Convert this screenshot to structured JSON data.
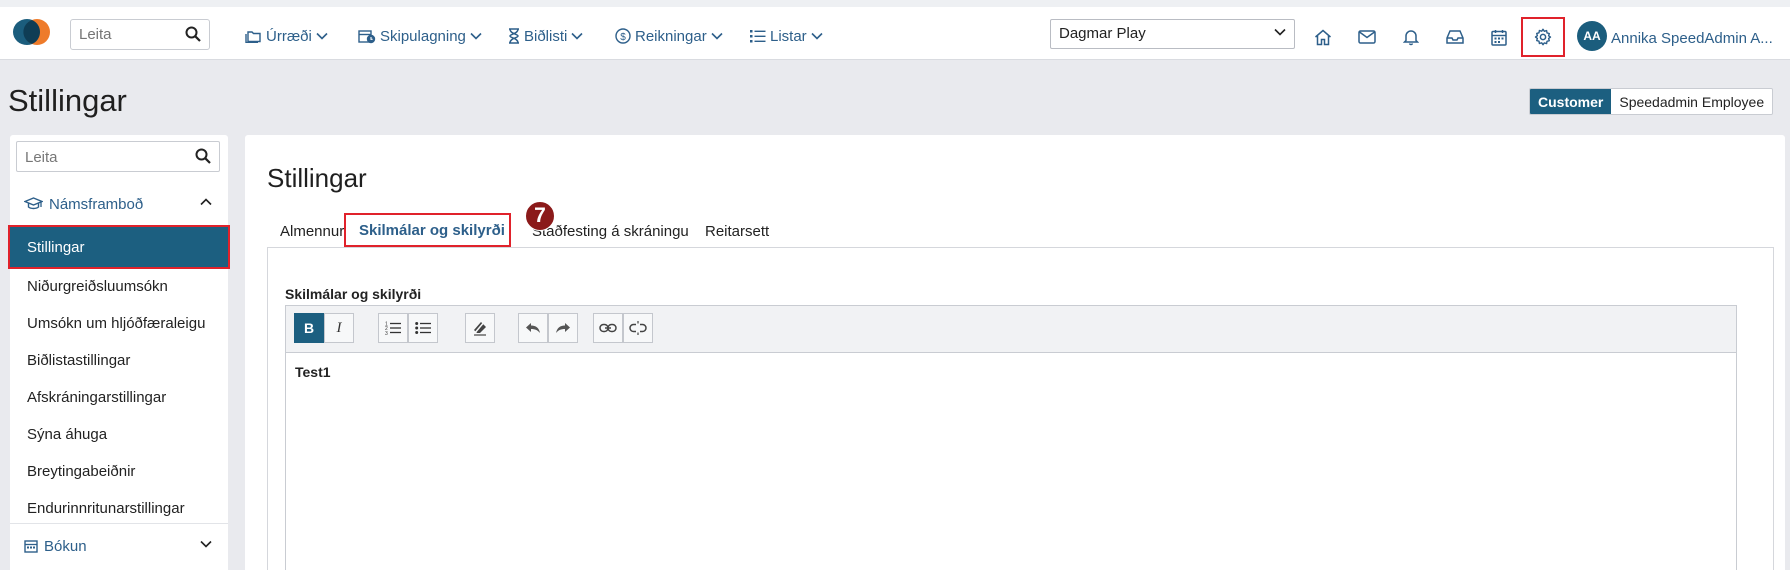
{
  "topbar": {
    "search_placeholder": "Leita",
    "nav": [
      {
        "label": "Úrræði",
        "icon": "folders-icon"
      },
      {
        "label": "Skipulagning",
        "icon": "calendar-clock-icon"
      },
      {
        "label": "Biðlisti",
        "icon": "hourglass-icon"
      },
      {
        "label": "Reikningar",
        "icon": "dollar-circle-icon"
      },
      {
        "label": "Listar",
        "icon": "list-icon"
      }
    ],
    "org_select": "Dagmar Play",
    "tools": [
      "home-icon",
      "mail-icon",
      "bell-icon",
      "inbox-icon",
      "calendar-icon",
      "gear-icon"
    ],
    "avatar_initials": "AA",
    "username": "Annika SpeedAdmin A..."
  },
  "page": {
    "title": "Stillingar",
    "toggle": {
      "customer": "Customer",
      "employee": "Speedadmin Employee"
    }
  },
  "sidebar": {
    "search_placeholder": "Leita",
    "group1": {
      "label": "Námsframboð",
      "icon": "graduation-cap-icon"
    },
    "items": [
      "Stillingar",
      "Niðurgreiðsluumsókn",
      "Umsókn um hljóðfæraleigu",
      "Biðlistastillingar",
      "Afskráningarstillingar",
      "Sýna áhuga",
      "Breytingabeiðnir",
      "Endurinnritunarstillingar"
    ],
    "group2": {
      "label": "Bókun",
      "icon": "calendar-icon"
    }
  },
  "main": {
    "title": "Stillingar",
    "tabs": [
      "Almennur",
      "Skilmálar og skilyrði",
      "Staðfesting á skráningu",
      "Reitarsett"
    ],
    "step_badge": "7",
    "field_label": "Skilmálar og skilyrði",
    "toolbar": [
      "B",
      "I"
    ],
    "editor_content": "Test1"
  },
  "colors": {
    "brand": "#1c5f80",
    "link": "#2d5f8a",
    "highlight": "#e0222b",
    "badge": "#8b1a1a"
  }
}
